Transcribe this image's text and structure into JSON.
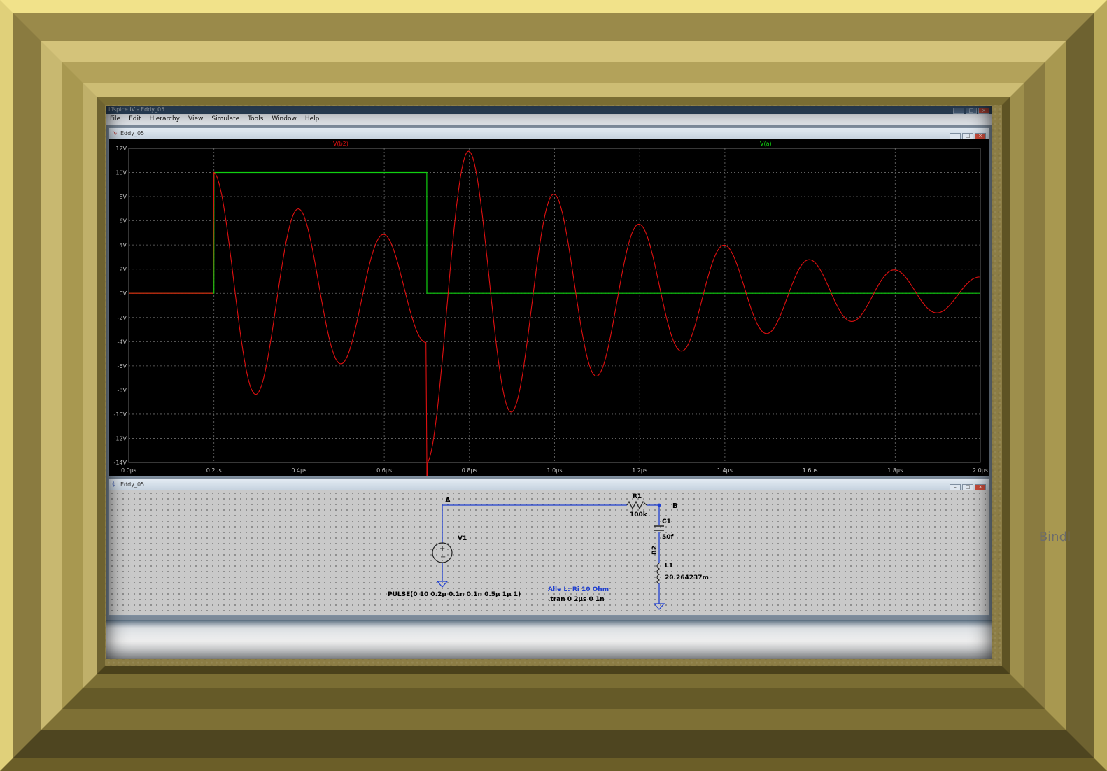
{
  "app": {
    "title": "LTspice IV - Eddy_05",
    "menu": [
      "File",
      "Edit",
      "Hierarchy",
      "View",
      "Simulate",
      "Tools",
      "Window",
      "Help"
    ]
  },
  "plot_window": {
    "title": "Eddy_05",
    "trace_labels": {
      "vb2": "V(b2)",
      "va": "V(a)"
    },
    "colors": {
      "background": "#000000",
      "grid": "#6e6e6e",
      "vb2": "#e01010",
      "va": "#10d010",
      "axis_text": "#c8c8c8"
    }
  },
  "chart_data": {
    "type": "line",
    "x_unit": "µs",
    "xlim": [
      0.0,
      2.0
    ],
    "ylim": [
      -14,
      12
    ],
    "x_ticks": [
      "0.0µs",
      "0.2µs",
      "0.4µs",
      "0.6µs",
      "0.8µs",
      "1.0µs",
      "1.2µs",
      "1.4µs",
      "1.6µs",
      "1.8µs",
      "2.0µs"
    ],
    "y_ticks": [
      "12V",
      "10V",
      "8V",
      "6V",
      "4V",
      "2V",
      "0V",
      "-2V",
      "-4V",
      "-6V",
      "-8V",
      "-10V",
      "-12V",
      "-14V"
    ],
    "grid": true,
    "series": [
      {
        "name": "V(a)",
        "color": "#10d010",
        "x": [
          0.0,
          0.2,
          0.2001,
          0.7,
          0.7001,
          2.0
        ],
        "y": [
          0,
          0,
          10,
          10,
          0,
          0
        ]
      },
      {
        "name": "V(b2)",
        "color": "#e01010",
        "x": [
          0.0,
          0.2,
          0.7,
          0.7001,
          2.0
        ],
        "y": [
          0,
          10,
          -2.9,
          -12.9,
          0.5
        ],
        "note_model": "damped ringing"
      }
    ]
  },
  "schematic_window": {
    "title": "Eddy_05",
    "node_a": "A",
    "node_b": "B",
    "r1_name": "R1",
    "r1_value": "100k",
    "c1_name": "C1",
    "c1_value": "50f",
    "b2_label": "B2",
    "l1_name": "L1",
    "l1_value": "20.264237m",
    "v1_name": "V1",
    "v1_value": "PULSE(0 10 0.2µ 0.1n 0.1n 0.5µ 1µ 1)",
    "comment": "Alle L: Ri 10 Ohm",
    "directive": ".tran 0 2µs 0 1n",
    "colors": {
      "wire": "#1f3fd0",
      "comment": "#1f3fd0",
      "text": "#000000",
      "component": "#3a4fc0"
    }
  },
  "signature": "Bindl"
}
